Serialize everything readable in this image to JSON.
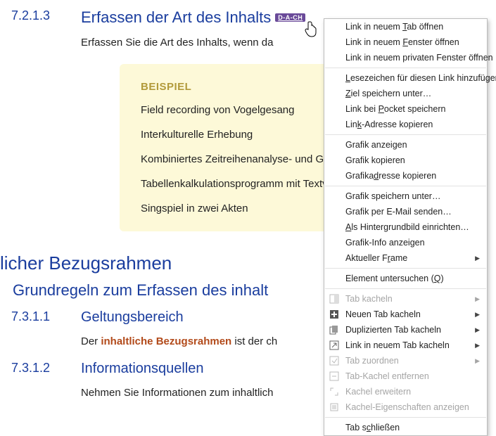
{
  "sec_7_2_1_3": {
    "num": "7.2.1.3",
    "title": "Erfassen der Art des Inhalts",
    "badge": "D-A-CH",
    "body": "Erfassen Sie die Art des Inhalts, wenn da"
  },
  "example": {
    "title": "BEISPIEL",
    "items": [
      "Field recording von Vogelgesang",
      "Interkulturelle Erhebung",
      "Kombiniertes Zeitreihenanalyse- und Gra",
      "Tabellenkalkulationsprogramm mit Textve",
      "Singspiel in zwei Akten"
    ]
  },
  "sec_bezug_title": "licher Bezugsrahmen",
  "sec_grundregeln": "Grundregeln zum Erfassen des inhalt",
  "sec_7_3_1_1": {
    "num": "7.3.1.1",
    "title": "Geltungsbereich",
    "body_pre": "Der ",
    "body_bold": "inhaltliche Bezugsrahmen",
    "body_post": " ist der ch"
  },
  "sec_7_3_1_2": {
    "num": "7.3.1.2",
    "title": "Informationsquellen",
    "body": "Nehmen Sie Informationen zum inhaltlich"
  },
  "ctx": {
    "open_tab": "Link in neuem Tab öffnen",
    "open_win": "Link in neuem Fenster öffnen",
    "open_priv": "Link in neuem privaten Fenster öffnen",
    "bookmark": "Lesezeichen für diesen Link hinzufügen",
    "save_target": "Ziel speichern unter…",
    "pocket": "Link bei Pocket speichern",
    "copy_link": "Link-Adresse kopieren",
    "show_img": "Grafik anzeigen",
    "copy_img": "Grafik kopieren",
    "copy_img_addr": "Grafikadresse kopieren",
    "save_img": "Grafik speichern unter…",
    "email_img": "Grafik per E-Mail senden…",
    "set_bg": "Als Hintergrundbild einrichten…",
    "img_info": "Grafik-Info anzeigen",
    "cur_frame": "Aktueller Frame",
    "inspect": "Element untersuchen (Q)",
    "tile_tab": "Tab kacheln",
    "tile_new": "Neuen Tab kacheln",
    "tile_dup": "Duplizierten Tab kacheln",
    "tile_link": "Link in neuem Tab kacheln",
    "tile_assign": "Tab zuordnen",
    "tile_remove": "Tab-Kachel entfernen",
    "tile_expand": "Kachel erweitern",
    "tile_props": "Kachel-Eigenschaften anzeigen",
    "close_tab": "Tab schließen"
  }
}
